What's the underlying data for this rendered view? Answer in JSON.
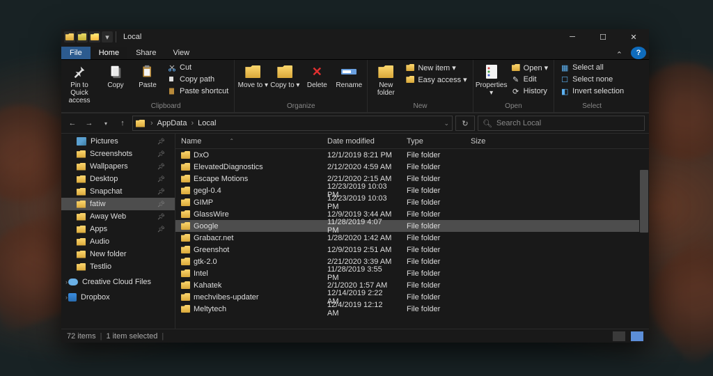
{
  "window": {
    "title": "Local"
  },
  "tabs": {
    "file": "File",
    "home": "Home",
    "share": "Share",
    "view": "View"
  },
  "ribbon": {
    "pin": "Pin to Quick access",
    "copy": "Copy",
    "paste": "Paste",
    "cut": "Cut",
    "copypath": "Copy path",
    "pasteshortcut": "Paste shortcut",
    "clipboard": "Clipboard",
    "moveto": "Move to ▾",
    "copyto": "Copy to ▾",
    "delete": "Delete",
    "rename": "Rename",
    "organize": "Organize",
    "newfolder": "New folder",
    "newitem": "New item ▾",
    "easyaccess": "Easy access ▾",
    "new": "New",
    "properties": "Properties ▾",
    "open": "Open ▾",
    "edit": "Edit",
    "history": "History",
    "opengroup": "Open",
    "selectall": "Select all",
    "selectnone": "Select none",
    "invert": "Invert selection",
    "select": "Select"
  },
  "breadcrumb": {
    "p1": "AppData",
    "p2": "Local"
  },
  "search": {
    "placeholder": "Search Local"
  },
  "columns": {
    "name": "Name",
    "date": "Date modified",
    "type": "Type",
    "size": "Size"
  },
  "nav": [
    {
      "label": "Pictures",
      "icon": "pic",
      "pin": true
    },
    {
      "label": "Screenshots",
      "icon": "folder",
      "pin": true
    },
    {
      "label": "Wallpapers",
      "icon": "folder",
      "pin": true
    },
    {
      "label": "Desktop",
      "icon": "folder",
      "pin": true
    },
    {
      "label": "Snapchat",
      "icon": "folder",
      "pin": true
    },
    {
      "label": "fatiw",
      "icon": "folder",
      "pin": true,
      "selected": true
    },
    {
      "label": "Away Web",
      "icon": "folder",
      "pin": true
    },
    {
      "label": "Apps",
      "icon": "folder",
      "pin": true
    },
    {
      "label": "Audio",
      "icon": "folder"
    },
    {
      "label": "New folder",
      "icon": "folder"
    },
    {
      "label": "Testlio",
      "icon": "folder"
    },
    {
      "label": "Creative Cloud Files",
      "icon": "cloud",
      "group": true,
      "chev": true
    },
    {
      "label": "Dropbox",
      "icon": "dropbox",
      "group": true,
      "chev": true
    }
  ],
  "rows": [
    {
      "name": "DxO",
      "date": "12/1/2019 8:21 PM",
      "type": "File folder"
    },
    {
      "name": "ElevatedDiagnostics",
      "date": "2/12/2020 4:59 AM",
      "type": "File folder"
    },
    {
      "name": "Escape Motions",
      "date": "2/21/2020 2:15 AM",
      "type": "File folder"
    },
    {
      "name": "gegl-0.4",
      "date": "12/23/2019 10:03 PM",
      "type": "File folder"
    },
    {
      "name": "GIMP",
      "date": "12/23/2019 10:03 PM",
      "type": "File folder"
    },
    {
      "name": "GlassWire",
      "date": "12/9/2019 3:44 AM",
      "type": "File folder"
    },
    {
      "name": "Google",
      "date": "11/28/2019 4:07 PM",
      "type": "File folder",
      "selected": true
    },
    {
      "name": "Grabacr.net",
      "date": "1/28/2020 1:42 AM",
      "type": "File folder"
    },
    {
      "name": "Greenshot",
      "date": "12/9/2019 2:51 AM",
      "type": "File folder"
    },
    {
      "name": "gtk-2.0",
      "date": "2/21/2020 3:39 AM",
      "type": "File folder"
    },
    {
      "name": "Intel",
      "date": "11/28/2019 3:55 PM",
      "type": "File folder"
    },
    {
      "name": "Kahatek",
      "date": "2/1/2020 1:57 AM",
      "type": "File folder"
    },
    {
      "name": "mechvibes-updater",
      "date": "12/14/2019 2:22 AM",
      "type": "File folder"
    },
    {
      "name": "Meltytech",
      "date": "12/4/2019 12:12 AM",
      "type": "File folder"
    }
  ],
  "status": {
    "items": "72 items",
    "selected": "1 item selected"
  }
}
